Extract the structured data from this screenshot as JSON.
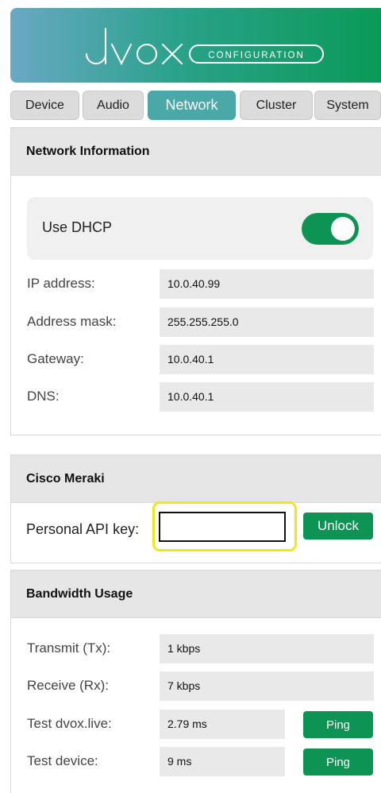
{
  "header": {
    "logo_text": "dvox",
    "logo_badge": "CONFIGURATION",
    "gradient_colors": [
      "#6aa8c4",
      "#2aa28a",
      "#0a9a57"
    ]
  },
  "tabs": [
    {
      "label": "Device",
      "active": false
    },
    {
      "label": "Audio",
      "active": false
    },
    {
      "label": "Network",
      "active": true
    },
    {
      "label": "Cluster",
      "active": false
    },
    {
      "label": "System",
      "active": false
    }
  ],
  "network_info": {
    "title": "Network Information",
    "dhcp_label": "Use DHCP",
    "dhcp_enabled": true,
    "rows": [
      {
        "label": "IP address:",
        "value": "10.0.40.99"
      },
      {
        "label": "Address mask:",
        "value": "255.255.255.0"
      },
      {
        "label": "Gateway:",
        "value": "10.0.40.1"
      },
      {
        "label": "DNS:",
        "value": "10.0.40.1"
      }
    ]
  },
  "meraki": {
    "title": "Cisco Meraki",
    "api_label": "Personal API key:",
    "api_value": "",
    "unlock_label": "Unlock"
  },
  "bandwidth": {
    "title": "Bandwidth Usage",
    "tx_label": "Transmit (Tx):",
    "tx_value": "1 kbps",
    "rx_label": "Receive (Rx):",
    "rx_value": "7 kbps",
    "live_label": "Test dvox.live:",
    "live_value": "2.79 ms",
    "device_label": "Test device:",
    "device_value": "9 ms",
    "ping_label": "Ping"
  },
  "colors": {
    "accent_green": "#0d9455",
    "active_tab": "#4aa8a8",
    "highlight": "#f4e51a"
  }
}
